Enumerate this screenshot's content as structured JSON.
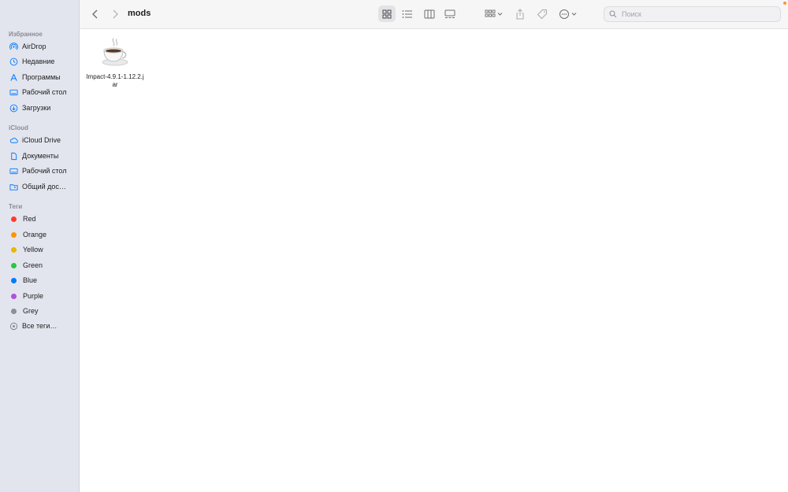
{
  "window": {
    "title": "mods"
  },
  "toolbar": {
    "back_icon": "chevron-left-icon",
    "forward_icon": "chevron-right-icon",
    "view_modes": [
      "icon-view",
      "list-view",
      "column-view",
      "gallery-view"
    ],
    "active_view": "icon-view",
    "search_placeholder": "Поиск"
  },
  "sidebar": {
    "favorites_header": "Избранное",
    "favorites": [
      {
        "label": "AirDrop",
        "icon": "airdrop-icon"
      },
      {
        "label": "Недавние",
        "icon": "clock-icon"
      },
      {
        "label": "Программы",
        "icon": "apps-icon"
      },
      {
        "label": "Рабочий стол",
        "icon": "desktop-icon"
      },
      {
        "label": "Загрузки",
        "icon": "download-icon"
      }
    ],
    "icloud_header": "iCloud",
    "icloud": [
      {
        "label": "iCloud Drive",
        "icon": "cloud-icon"
      },
      {
        "label": "Документы",
        "icon": "document-icon"
      },
      {
        "label": "Рабочий стол",
        "icon": "desktop-icon"
      },
      {
        "label": "Общий дос…",
        "icon": "shared-folder-icon"
      }
    ],
    "tags_header": "Теги",
    "tags": [
      {
        "label": "Red",
        "color": "#ff3b30"
      },
      {
        "label": "Orange",
        "color": "#ff9500"
      },
      {
        "label": "Yellow",
        "color": "#e8b800"
      },
      {
        "label": "Green",
        "color": "#28c840"
      },
      {
        "label": "Blue",
        "color": "#007aff"
      },
      {
        "label": "Purple",
        "color": "#af52de"
      },
      {
        "label": "Grey",
        "color": "#8e8e93"
      }
    ],
    "all_tags": "Все теги…"
  },
  "content": {
    "files": [
      {
        "name": "Impact-4.9.1-1.12.2.jar",
        "icon": "java-coffee-cup-icon"
      }
    ]
  },
  "colors": {
    "sidebar_bg": "#e3e5ee",
    "accent": "#007aff"
  }
}
